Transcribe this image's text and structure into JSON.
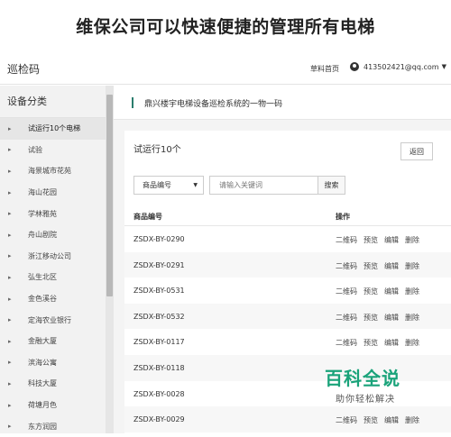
{
  "caption": "维保公司可以快速便捷的管理所有电梯",
  "topbar": {
    "brand": "巡检码",
    "home_link": "草料首页",
    "user_email": "413502421@qq.com"
  },
  "sidebar": {
    "title": "设备分类",
    "items": [
      {
        "label": "试运行10个电梯",
        "active": true
      },
      {
        "label": "试验"
      },
      {
        "label": "海景城市花苑"
      },
      {
        "label": "海山花园"
      },
      {
        "label": "学林雅苑"
      },
      {
        "label": "舟山剧院"
      },
      {
        "label": "浙江移动公司"
      },
      {
        "label": "弘生北区"
      },
      {
        "label": "金色溪谷"
      },
      {
        "label": "定海农业银行"
      },
      {
        "label": "金融大厦"
      },
      {
        "label": "滨海公寓"
      },
      {
        "label": "科技大厦"
      },
      {
        "label": "荷塘月色"
      },
      {
        "label": "东方润园"
      }
    ]
  },
  "main": {
    "header_text": "鼎兴楼宇电梯设备巡检系统的一物一码",
    "panel_title": "试运行10个",
    "back_label": "返回",
    "filter": {
      "selected": "商品编号",
      "placeholder": "请输入关键词",
      "search_label": "搜索"
    },
    "table": {
      "headers": [
        "商品编号",
        "操作"
      ],
      "rows": [
        {
          "code": "ZSDX-BY-0290",
          "ops": [
            "二维码",
            "预览",
            "编辑",
            "删除"
          ]
        },
        {
          "code": "ZSDX-BY-0291",
          "ops": [
            "二维码",
            "预览",
            "编辑",
            "删除"
          ]
        },
        {
          "code": "ZSDX-BY-0531",
          "ops": [
            "二维码",
            "预览",
            "编辑",
            "删除"
          ]
        },
        {
          "code": "ZSDX-BY-0532",
          "ops": [
            "二维码",
            "预览",
            "编辑",
            "删除"
          ]
        },
        {
          "code": "ZSDX-BY-0117",
          "ops": [
            "二维码",
            "预览",
            "编辑",
            "删除"
          ]
        },
        {
          "code": "ZSDX-BY-0118",
          "ops": []
        },
        {
          "code": "ZSDX-BY-0028",
          "ops": []
        },
        {
          "code": "ZSDX-BY-0029",
          "ops": [
            "二维码",
            "预览",
            "编辑",
            "删除"
          ]
        }
      ]
    }
  },
  "watermark": {
    "title": "百科全说",
    "subtitle": "助你轻松解决"
  },
  "colors": {
    "accent": "#2a7d6d",
    "watermark_green": "#1aa37a",
    "sidebar_bg": "#f2f2f2"
  }
}
